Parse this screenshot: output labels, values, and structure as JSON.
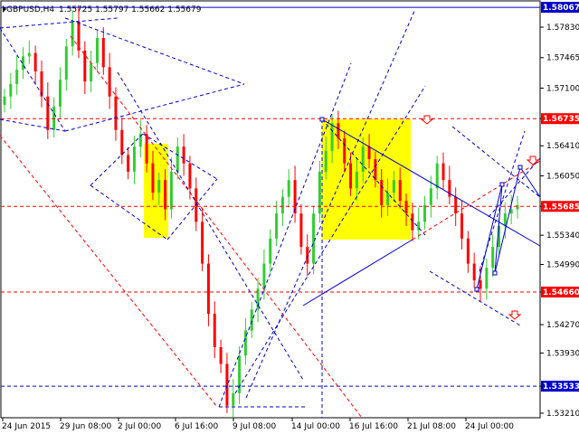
{
  "window": {
    "title": "GBPUSD,H4",
    "ohlc": "1.55725 1.55797 1.55662 1.55679"
  },
  "colors": {
    "background": "#ffffff",
    "bull": "#32cd32",
    "bear": "#ff0000",
    "support_resistance": "#ff0000",
    "channel": "#0000cd",
    "highlight": "#ffff00",
    "tag_blue": "#0000cd",
    "tag_red": "#ff0000"
  },
  "chart_data": {
    "type": "candlestick",
    "symbol": "GBPUSD",
    "timeframe": "H4",
    "y_ticks": [
      "1.57830",
      "1.57465",
      "1.57100",
      "1.56735",
      "1.56410",
      "1.56050",
      "1.55685",
      "1.55340",
      "1.54990",
      "1.54660",
      "1.54270",
      "1.53930",
      "1.53533",
      "1.53210"
    ],
    "x_ticks": [
      "24 Jun 2015",
      "29 Jun 08:00",
      "2 Jul 00:00",
      "6 Jul 16:00",
      "9 Jul 08:00",
      "14 Jul 00:00",
      "16 Jul 16:00",
      "21 Jul 08:00",
      "24 Jul 00:00"
    ],
    "price_tags": [
      {
        "label": "1.58067",
        "value": 1.58067,
        "color": "blue"
      },
      {
        "label": "1.56735",
        "value": 1.56735,
        "color": "red"
      },
      {
        "label": "1.55685",
        "value": 1.55685,
        "color": "red"
      },
      {
        "label": "1.54660",
        "value": 1.5466,
        "color": "red"
      },
      {
        "label": "1.53533",
        "value": 1.53533,
        "color": "blue"
      }
    ],
    "horizontal_levels": [
      1.58067,
      1.56735,
      1.55685,
      1.5466,
      1.53533
    ],
    "close_path": [
      1.57,
      1.5715,
      1.5732,
      1.5748,
      1.5752,
      1.573,
      1.57,
      1.566,
      1.5688,
      1.572,
      1.576,
      1.579,
      1.5755,
      1.5718,
      1.574,
      1.577,
      1.5735,
      1.57,
      1.566,
      1.563,
      1.561,
      1.564,
      1.5655,
      1.562,
      1.5585,
      1.56,
      1.5565,
      1.561,
      1.564,
      1.562,
      1.559,
      1.555,
      1.55,
      1.544,
      1.54,
      1.538,
      1.533,
      1.5345,
      1.539,
      1.542,
      1.5445,
      1.547,
      1.55,
      1.553,
      1.556,
      1.558,
      1.56,
      1.556,
      1.552,
      1.55,
      1.556,
      1.561,
      1.5635,
      1.5668,
      1.565,
      1.562,
      1.559,
      1.561,
      1.564,
      1.5625,
      1.56,
      1.557,
      1.5585,
      1.56,
      1.5575,
      1.556,
      1.554,
      1.555,
      1.557,
      1.559,
      1.562,
      1.56,
      1.558,
      1.556,
      1.553,
      1.55,
      1.548,
      1.547,
      1.5495,
      1.552,
      1.5545,
      1.556,
      1.5565,
      1.557
    ]
  }
}
